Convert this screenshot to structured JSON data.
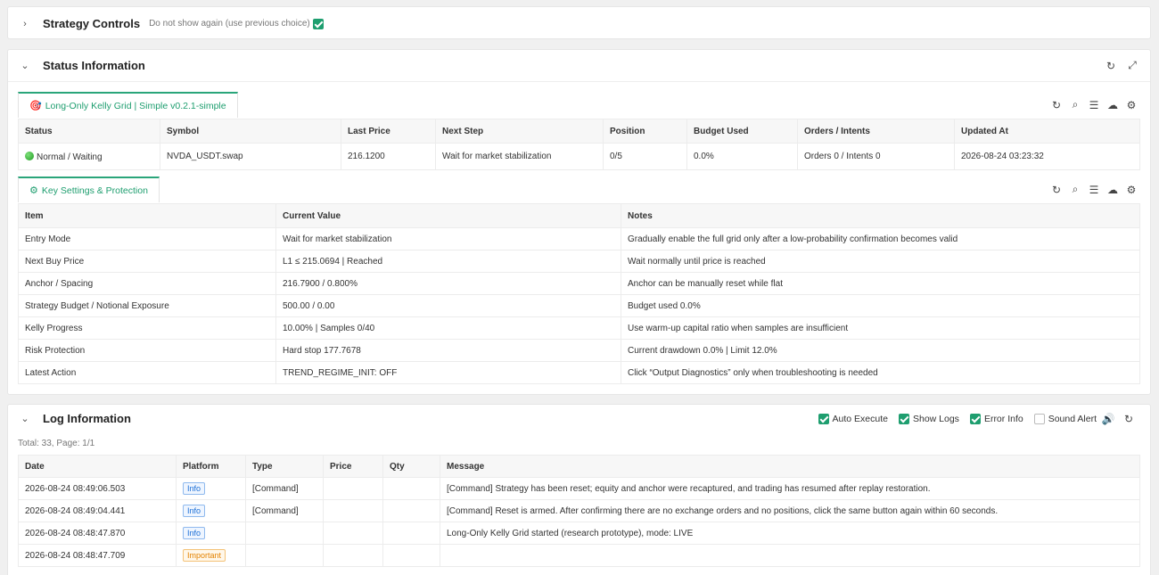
{
  "strategy_controls": {
    "title": "Strategy Controls",
    "dont_show_label": "Do not show again (use previous choice)",
    "dont_show_checked": true
  },
  "status_info": {
    "title": "Status Information",
    "tab_label": "Long-Only Kelly Grid | Simple v0.2.1-simple",
    "columns": [
      "Status",
      "Symbol",
      "Last Price",
      "Next Step",
      "Position",
      "Budget Used",
      "Orders / Intents",
      "Updated At"
    ],
    "row": {
      "status": "Normal / Waiting",
      "symbol": "NVDA_USDT.swap",
      "last_price": "216.1200",
      "next_step": "Wait for market stabilization",
      "position": "0/5",
      "budget_used": "0.0%",
      "orders_intents": "Orders 0 / Intents 0",
      "updated_at": "2026-08-24 03:23:32"
    }
  },
  "key_settings": {
    "tab_label": "Key Settings & Protection",
    "columns": [
      "Item",
      "Current Value",
      "Notes"
    ],
    "rows": [
      {
        "item": "Entry Mode",
        "value": "Wait for market stabilization",
        "notes": "Gradually enable the full grid only after a low-probability confirmation becomes valid"
      },
      {
        "item": "Next Buy Price",
        "value": "L1 ≤ 215.0694 | Reached",
        "notes": "Wait normally until price is reached"
      },
      {
        "item": "Anchor / Spacing",
        "value": "216.7900 / 0.800%",
        "notes": "Anchor can be manually reset while flat"
      },
      {
        "item": "Strategy Budget / Notional Exposure",
        "value": "500.00 / 0.00",
        "notes": "Budget used 0.0%"
      },
      {
        "item": "Kelly Progress",
        "value": "10.00% | Samples 0/40",
        "notes": "Use warm-up capital ratio when samples are insufficient"
      },
      {
        "item": "Risk Protection",
        "value": "Hard stop 177.7678",
        "notes": "Current drawdown 0.0% | Limit 12.0%"
      },
      {
        "item": "Latest Action",
        "value": "TREND_REGIME_INIT: OFF",
        "notes": "Click “Output Diagnostics” only when troubleshooting is needed"
      }
    ]
  },
  "log_info": {
    "title": "Log Information",
    "options": {
      "auto_execute": {
        "label": "Auto Execute",
        "checked": true
      },
      "show_logs": {
        "label": "Show Logs",
        "checked": true
      },
      "error_info": {
        "label": "Error Info",
        "checked": true
      },
      "sound_alert": {
        "label": "Sound Alert",
        "checked": false
      }
    },
    "summary": "Total: 33, Page: 1/1",
    "columns": [
      "Date",
      "Platform",
      "Type",
      "Price",
      "Qty",
      "Message"
    ],
    "rows": [
      {
        "date": "2026-08-24 08:49:06.503",
        "platform": "Info",
        "level": "info",
        "type": "[Command]",
        "price": "",
        "qty": "",
        "message": "[Command] Strategy has been reset; equity and anchor were recaptured, and trading has resumed after replay restoration."
      },
      {
        "date": "2026-08-24 08:49:04.441",
        "platform": "Info",
        "level": "info",
        "type": "[Command]",
        "price": "",
        "qty": "",
        "message": "[Command] Reset is armed. After confirming there are no exchange orders and no positions, click the same button again within 60 seconds."
      },
      {
        "date": "2026-08-24 08:48:47.870",
        "platform": "Info",
        "level": "info",
        "type": "",
        "price": "",
        "qty": "",
        "message": "Long-Only Kelly Grid started (research prototype), mode: LIVE"
      },
      {
        "date": "2026-08-24 08:48:47.709",
        "platform": "Important",
        "level": "important",
        "type": "",
        "price": "",
        "qty": "",
        "message": ""
      }
    ]
  },
  "colors": {
    "accent": "#1e9e6f",
    "info": "#1c6fd6",
    "important": "#e38200"
  }
}
